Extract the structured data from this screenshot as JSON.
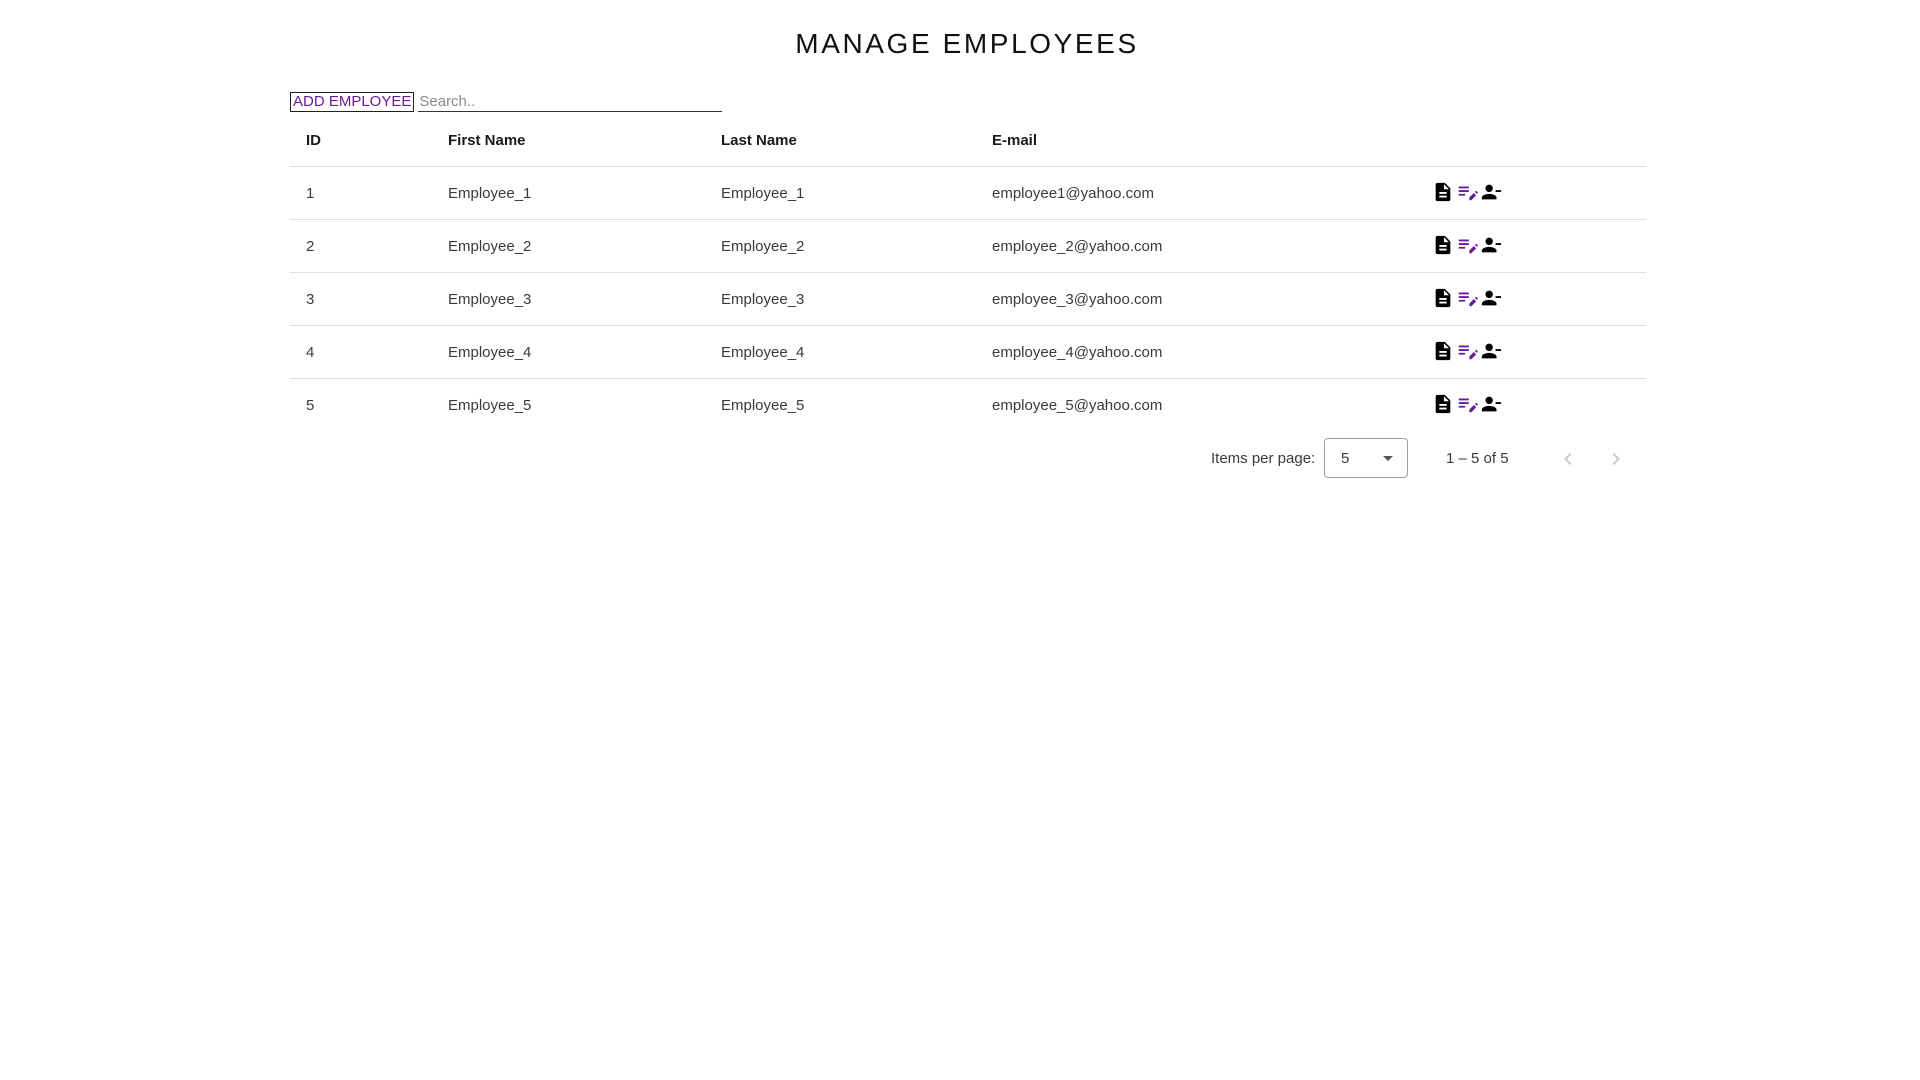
{
  "page": {
    "title": "MANAGE EMPLOYEES"
  },
  "toolbar": {
    "add_label": "ADD EMPLOYEE",
    "search_placeholder": "Search.."
  },
  "table": {
    "columns": [
      "ID",
      "First Name",
      "Last Name",
      "E-mail",
      ""
    ],
    "rows": [
      {
        "id": "1",
        "first": "Employee_1",
        "last": "Employee_1",
        "email": "employee1@yahoo.com"
      },
      {
        "id": "2",
        "first": "Employee_2",
        "last": "Employee_2",
        "email": "employee_2@yahoo.com"
      },
      {
        "id": "3",
        "first": "Employee_3",
        "last": "Employee_3",
        "email": "employee_3@yahoo.com"
      },
      {
        "id": "4",
        "first": "Employee_4",
        "last": "Employee_4",
        "email": "employee_4@yahoo.com"
      },
      {
        "id": "5",
        "first": "Employee_5",
        "last": "Employee_5",
        "email": "employee_5@yahoo.com"
      }
    ],
    "row_actions": [
      "document-icon",
      "edit-note-icon",
      "remove-person-icon"
    ]
  },
  "paginator": {
    "items_per_page_label": "Items per page:",
    "items_per_page_value": "5",
    "range_label": "1 – 5 of 5"
  },
  "colors": {
    "accent": "#6a1b9a",
    "icon_dark": "#000000"
  }
}
